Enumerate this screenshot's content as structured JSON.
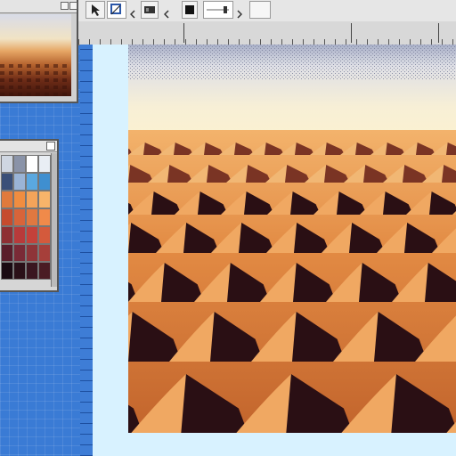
{
  "colors": {
    "workspace": "#3a7bd5",
    "toolbar": "#e6e6e6",
    "canvas_bg": "#d8f2ff",
    "sky_top": "#c9cee2",
    "sky_horizon": "#f8edcc",
    "dune_light": "#f3b06a",
    "dune_mid": "#d97834",
    "dune_shadow": "#2a0f14"
  },
  "palette": {
    "rows": [
      [
        "#cfd6e1",
        "#8a93a8",
        "#ffffff",
        "#e9eef4"
      ],
      [
        "#3a4f78",
        "#9ab4d6",
        "#5aa8e0",
        "#3f8fd0"
      ],
      [
        "#e07a3c",
        "#f08d40",
        "#f4a45a",
        "#f7b46a"
      ],
      [
        "#c64b2e",
        "#d8643a",
        "#e07840",
        "#f08a4a"
      ],
      [
        "#8e2f33",
        "#b83a3a",
        "#c4413a",
        "#d45a3c"
      ],
      [
        "#5a1d2a",
        "#7a2a36",
        "#8e3438",
        "#a63f3a"
      ],
      [
        "#1a0a12",
        "#2a1018",
        "#3a1620",
        "#4a1c24"
      ]
    ]
  },
  "icons": {
    "toolbar": [
      "select-arrow-icon",
      "crop-tool-icon",
      "layer-icon",
      "stop-icon",
      "slider-icon"
    ]
  }
}
